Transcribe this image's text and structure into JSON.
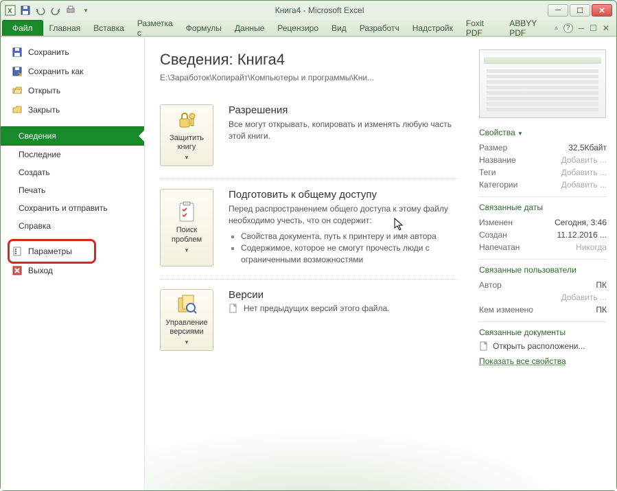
{
  "window": {
    "title": "Книга4 - Microsoft Excel"
  },
  "ribbon": {
    "tabs": [
      "Файл",
      "Главная",
      "Вставка",
      "Разметка с",
      "Формулы",
      "Данные",
      "Рецензиро",
      "Вид",
      "Разработч",
      "Надстройк",
      "Foxit PDF",
      "ABBYY PDF"
    ]
  },
  "sidebar": {
    "save": "Сохранить",
    "saveas": "Сохранить как",
    "open": "Открыть",
    "close": "Закрыть",
    "info": "Сведения",
    "recent": "Последние",
    "new": "Создать",
    "print": "Печать",
    "send": "Сохранить и отправить",
    "help": "Справка",
    "options": "Параметры",
    "exit": "Выход"
  },
  "main": {
    "title": "Сведения: Книга4",
    "path": "E:\\Заработок\\Копирайт\\Компьютеры и программы\\Кни...",
    "permissions": {
      "btn": "Защитить книгу",
      "title": "Разрешения",
      "desc": "Все могут открывать, копировать и изменять любую часть этой книги."
    },
    "prepare": {
      "btn": "Поиск проблем",
      "title": "Подготовить к общему доступу",
      "desc": "Перед распространением общего доступа к этому файлу необходимо учесть, что он содержит:",
      "b1": "Свойства документа, путь к принтеру и имя автора",
      "b2": "Содержимое, которое не смогут прочесть люди с ограниченными возможностями"
    },
    "versions": {
      "btn": "Управление версиями",
      "title": "Версии",
      "desc": "Нет предыдущих версий этого файла."
    }
  },
  "right": {
    "props_head": "Свойства",
    "size_k": "Размер",
    "size_v": "32,5Кбайт",
    "title_k": "Название",
    "title_v": "Добавить ...",
    "tags_k": "Теги",
    "tags_v": "Добавить ...",
    "cat_k": "Категории",
    "cat_v": "Добавить ...",
    "dates_head": "Связанные даты",
    "mod_k": "Изменен",
    "mod_v": "Сегодня, 3:46",
    "created_k": "Создан",
    "created_v": "11.12.2016 ...",
    "printed_k": "Напечатан",
    "printed_v": "Никогда",
    "users_head": "Связанные пользователи",
    "author_k": "Автор",
    "author_v": "ПК",
    "author_add": "Добавить ...",
    "lastmod_k": "Кем изменено",
    "lastmod_v": "ПК",
    "docs_head": "Связанные документы",
    "open_loc": "Открыть расположени...",
    "show_all": "Показать все свойства"
  }
}
